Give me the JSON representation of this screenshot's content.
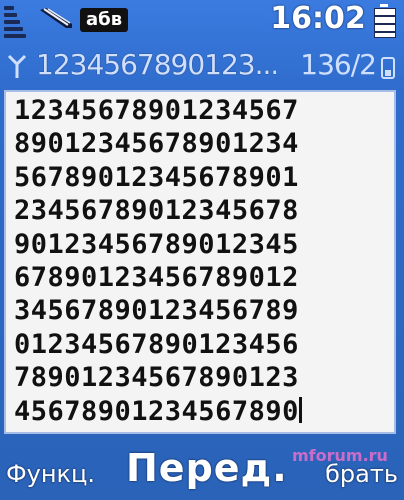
{
  "status_bar": {
    "keyboard_mode": "абв",
    "time": "16:02"
  },
  "header": {
    "preview_text": "1234567890123...",
    "char_count": "136/2"
  },
  "editor": {
    "lines": [
      "12345678901234567",
      "89012345678901234",
      "56789012345678901",
      "23456789012345678",
      "90123456789012345",
      "67890123456789012",
      "34567890123456789",
      "01234567890123456",
      "78901234567890123",
      "45678901234567890"
    ]
  },
  "softkeys": {
    "left": "Функц.",
    "center": "Перед.",
    "right": "брать"
  },
  "watermark": {
    "text": "mforum.ru"
  },
  "colors": {
    "background": "#2a63b8",
    "editor_bg": "#f4f4f4",
    "text": "#111111",
    "softkey_text": "#ffffff"
  }
}
